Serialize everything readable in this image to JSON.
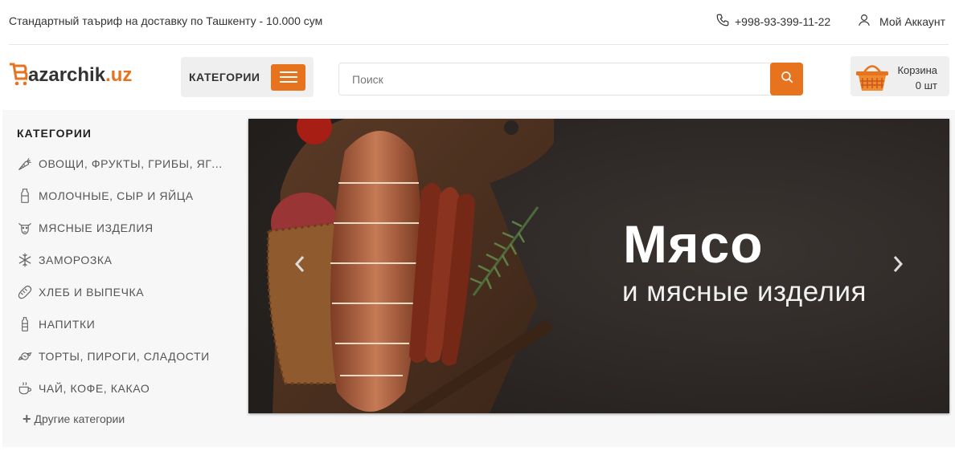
{
  "topbar": {
    "tariff_text": "Стандартный таъриф на доставку по Ташкенту - 10.000 сум",
    "phone": "+998-93-399-11-22",
    "account_label": "Мой Аккаунт"
  },
  "header": {
    "logo": {
      "b": "B",
      "name": "azarchik",
      "tld": ".uz"
    },
    "categories_button": "КАТЕГОРИИ",
    "search_placeholder": "Поиск",
    "cart": {
      "title": "Корзина",
      "count": "0 шт"
    }
  },
  "sidebar": {
    "title": "КАТЕГОРИИ",
    "items": [
      {
        "label": "ОВОЩИ, ФРУКТЫ, ГРИБЫ, ЯГОДЫ",
        "icon": "carrot-icon"
      },
      {
        "label": "МОЛОЧНЫЕ, СЫР И ЯЙЦА",
        "icon": "milk-bottle-icon"
      },
      {
        "label": "МЯСНЫЕ ИЗДЕЛИЯ",
        "icon": "cow-icon"
      },
      {
        "label": "ЗАМОРОЗКА",
        "icon": "snowflake-icon"
      },
      {
        "label": "ХЛЕБ И ВЫПЕЧКА",
        "icon": "bread-icon"
      },
      {
        "label": "НАПИТКИ",
        "icon": "drink-bottle-icon"
      },
      {
        "label": "ТОРТЫ, ПИРОГИ, СЛАДОСТИ",
        "icon": "candy-icon"
      },
      {
        "label": "ЧАЙ, КОФЕ, КАКАО",
        "icon": "tea-cup-icon"
      }
    ],
    "more_label": "Другие категории"
  },
  "banner": {
    "title": "Мясо",
    "subtitle": "и мясные изделия"
  },
  "colors": {
    "accent": "#e8731f",
    "banner_bg": "#2a2523",
    "panel_bg": "#f7f7f7"
  }
}
